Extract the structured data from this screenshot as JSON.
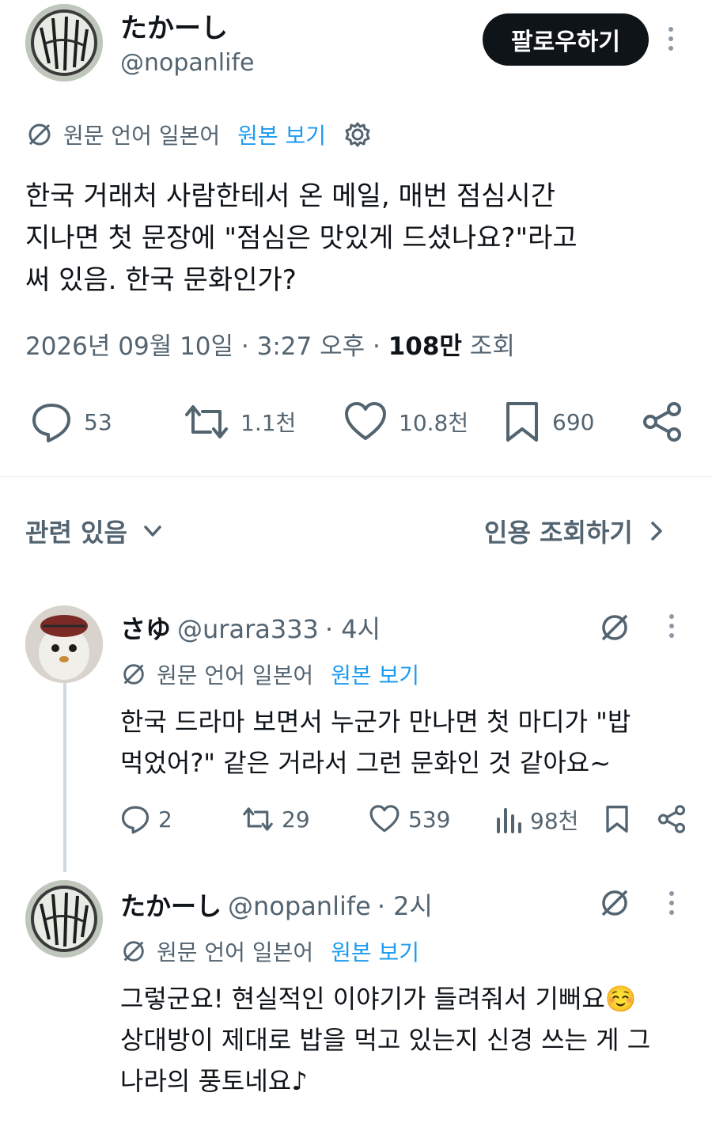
{
  "post": {
    "author_name": "たかーし",
    "author_handle": "@nopanlife",
    "follow_label": "팔로우하기",
    "translate_label": "원문 언어 일본어",
    "view_original": "원본 보기",
    "body_lines": [
      "한국 거래처 사람한테서 온 메일, 매번 점심시간",
      "지나면 첫 문장에 \"점심은 맛있게 드셨나요?\"라고",
      "써 있음. 한국 문화인가?"
    ],
    "meta_datetime": "2026년 09월 10일 · 3:27 오후 ·",
    "meta_views": "108만",
    "meta_views_label": "조회",
    "stats": {
      "replies": "53",
      "reposts": "1.1천",
      "likes": "10.8천",
      "bookmarks": "690"
    }
  },
  "related": {
    "label": "관련 있음",
    "quotes_label": "인용 조회하기"
  },
  "replies": [
    {
      "name": "さゆ",
      "handle": "@urara333",
      "time": "· 4시",
      "translate_label": "원문 언어 일본어",
      "view_original": "원본 보기",
      "lines": [
        "한국 드라마 보면서 누군가 만나면 첫 마디가 \"밥",
        "먹었어?\" 같은 거라서 그런 문화인 것 같아요~"
      ],
      "stats": {
        "replies": "2",
        "reposts": "29",
        "likes": "539",
        "views": "98천"
      }
    },
    {
      "name": "たかーし",
      "handle": "@nopanlife",
      "time": "· 2시",
      "translate_label": "원문 언어 일본어",
      "view_original": "원본 보기",
      "lines": [
        "그렇군요! 현실적인 이야기가 들려줘서 기뻐요☺️",
        "상대방이 제대로 밥을 먹고 있는지 신경 쓰는 게 그",
        "나라의 풍토네요♪"
      ]
    }
  ],
  "icons": [
    "translate-icon",
    "gear-icon",
    "reply-icon",
    "repost-icon",
    "like-icon",
    "bookmark-icon",
    "share-icon",
    "chevron-down-icon",
    "chevron-right-icon",
    "grok-icon",
    "views-icon",
    "more-icon"
  ],
  "colors": {
    "accent": "#1d9bf0",
    "text": "#0f1419",
    "muted": "#536471",
    "button": "#0f1419"
  }
}
